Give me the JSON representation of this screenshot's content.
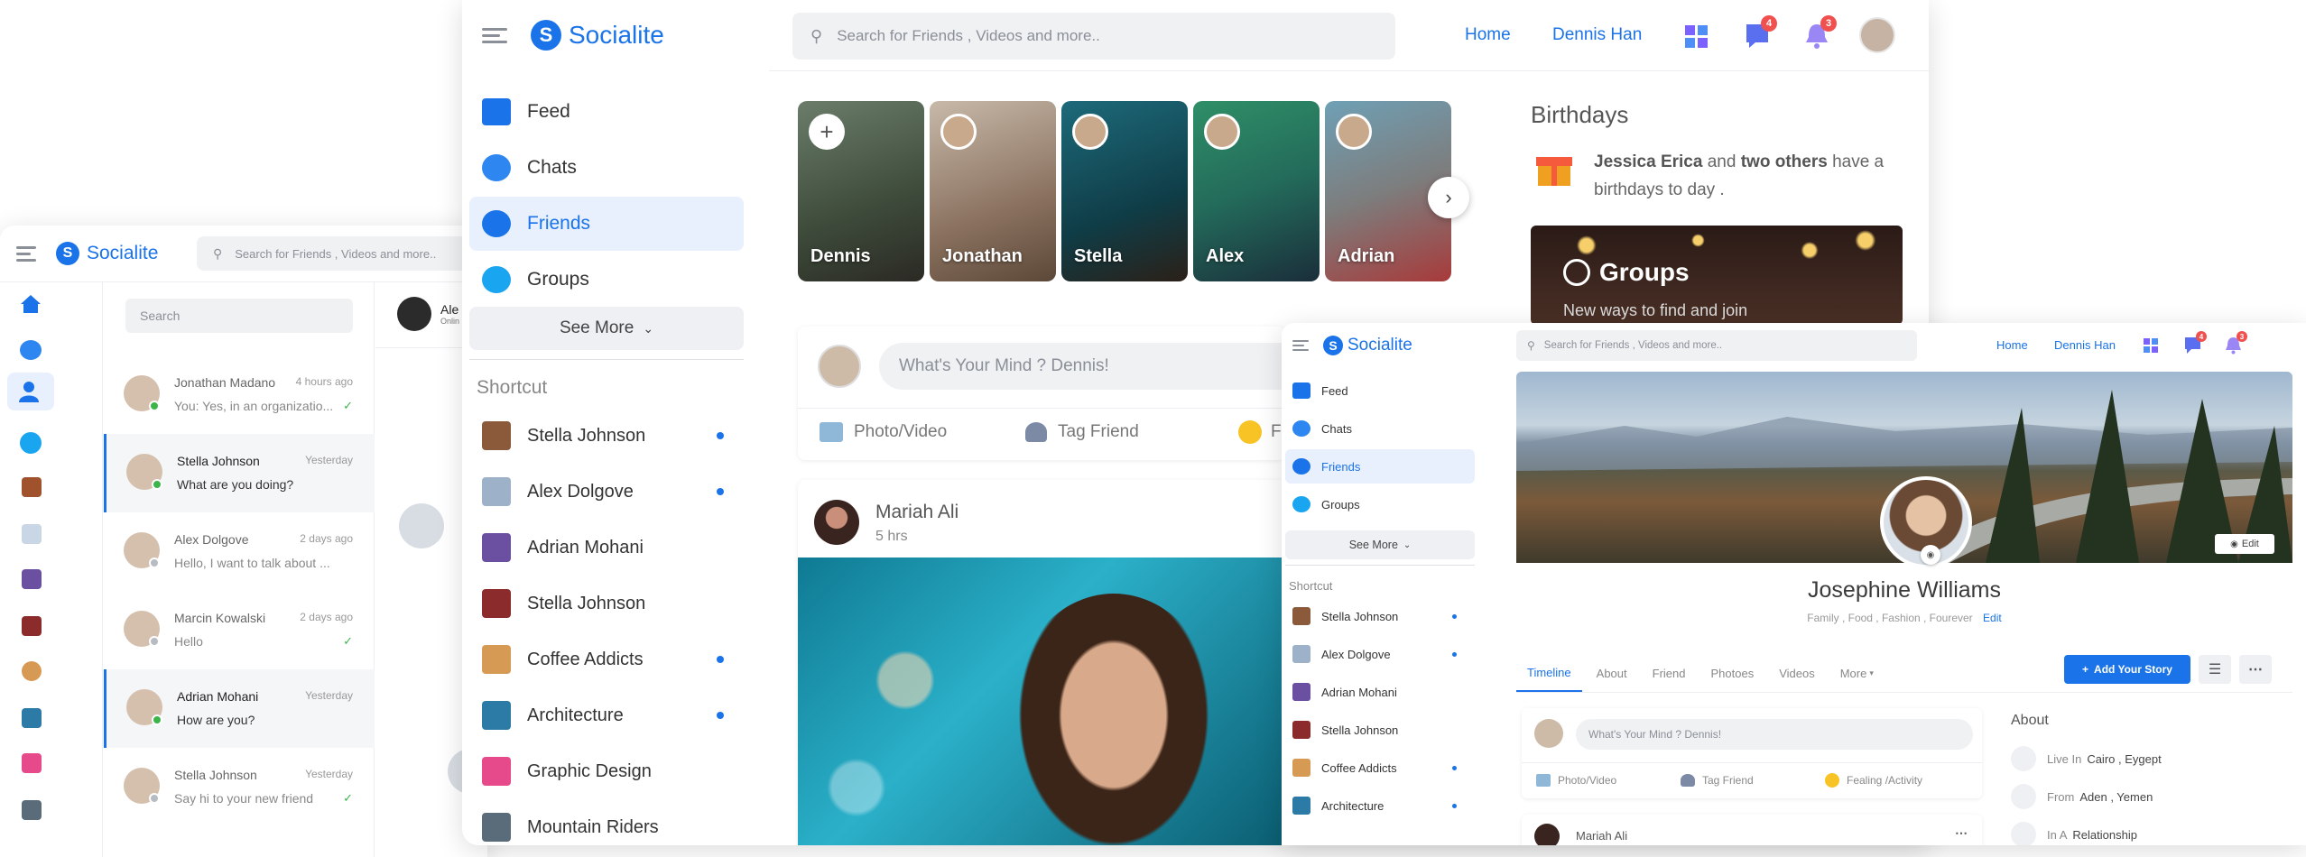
{
  "brand": "Socialite",
  "colors": {
    "accent": "#1a73e8",
    "badge": "#f0514f",
    "active_bg": "#e8f0fe"
  },
  "main": {
    "search_placeholder": "Search for Friends , Videos and more..",
    "nav": {
      "home": "Home",
      "user": "Dennis Han"
    },
    "badges": {
      "messages": "4",
      "notifications": "3"
    },
    "sidebar": [
      {
        "label": "Feed",
        "icon": "home-icon"
      },
      {
        "label": "Chats",
        "icon": "chat-icon"
      },
      {
        "label": "Friends",
        "icon": "friends-icon"
      },
      {
        "label": "Groups",
        "icon": "groups-icon"
      }
    ],
    "see_more": "See More",
    "shortcut_title": "Shortcut",
    "shortcuts": [
      {
        "label": "Stella Johnson",
        "dot": true
      },
      {
        "label": "Alex Dolgove",
        "dot": true
      },
      {
        "label": "Adrian Mohani",
        "dot": false
      },
      {
        "label": "Stella Johnson",
        "dot": false
      },
      {
        "label": "Coffee Addicts",
        "dot": true
      },
      {
        "label": "Architecture",
        "dot": true
      },
      {
        "label": "Graphic Design",
        "dot": false
      },
      {
        "label": "Mountain Riders",
        "dot": false
      }
    ],
    "stories": [
      "Dennis",
      "Jonathan",
      "Stella",
      "Alex",
      "Adrian"
    ],
    "composer": {
      "placeholder": "What's Your Mind ? Dennis!",
      "photo": "Photo/Video",
      "tag": "Tag Friend",
      "feeling": "Fe"
    },
    "post": {
      "author": "Mariah Ali",
      "time": "5 hrs"
    },
    "birthdays": {
      "title": "Birthdays",
      "name": "Jessica Erica",
      "and": "and",
      "others": "two others",
      "rest": "have a birthdays to day ."
    },
    "groups_card": {
      "title": "Groups",
      "subtitle": "New ways to find and join"
    }
  },
  "chat_app": {
    "search_placeholder": "Search for Friends , Videos and more..",
    "list_search": "Search",
    "header_name": "Ale",
    "header_status": "Onlin",
    "conversations": [
      {
        "name": "Jonathan Madano",
        "time": "4 hours ago",
        "msg": "You: Yes, in an organizatio...",
        "check": true,
        "active": false,
        "online": true
      },
      {
        "name": "Stella Johnson",
        "time": "Yesterday",
        "msg": "What are you doing?",
        "check": false,
        "active": true,
        "online": true
      },
      {
        "name": "Alex Dolgove",
        "time": "2 days ago",
        "msg": "Hello, I want to talk about ...",
        "check": false,
        "active": false,
        "online": false
      },
      {
        "name": "Marcin Kowalski",
        "time": "2 days ago",
        "msg": "Hello",
        "check": true,
        "active": false,
        "online": false
      },
      {
        "name": "Adrian Mohani",
        "time": "Yesterday",
        "msg": "How are you?",
        "check": false,
        "active": true,
        "online": true
      },
      {
        "name": "Stella Johnson",
        "time": "Yesterday",
        "msg": "Say hi to your new friend",
        "check": true,
        "active": false,
        "online": false
      }
    ]
  },
  "profile_app": {
    "search_placeholder": "Search for Friends , Videos and more..",
    "nav": {
      "home": "Home",
      "user": "Dennis Han"
    },
    "badges": {
      "messages": "4",
      "notifications": "3"
    },
    "sidebar": [
      "Feed",
      "Chats",
      "Friends",
      "Groups"
    ],
    "see_more": "See More",
    "shortcut_title": "Shortcut",
    "shortcuts": [
      {
        "label": "Stella Johnson",
        "dot": true
      },
      {
        "label": "Alex Dolgove",
        "dot": true
      },
      {
        "label": "Adrian Mohani",
        "dot": false
      },
      {
        "label": "Stella Johnson",
        "dot": false
      },
      {
        "label": "Coffee Addicts",
        "dot": true
      },
      {
        "label": "Architecture",
        "dot": true
      }
    ],
    "cover_edit": "Edit",
    "name": "Josephine Williams",
    "interests": "Family , Food , Fashion , Fourever",
    "interests_edit": "Edit",
    "tabs": [
      "Timeline",
      "About",
      "Friend",
      "Photoes",
      "Videos",
      "More"
    ],
    "add_story": "Add Your Story",
    "composer": {
      "placeholder": "What's Your Mind ? Dennis!",
      "photo": "Photo/Video",
      "tag": "Tag Friend",
      "feeling": "Fealing /Activity"
    },
    "about_title": "About",
    "about": [
      {
        "prefix": "Live In",
        "value": "Cairo , Eygept"
      },
      {
        "prefix": "From",
        "value": "Aden , Yemen"
      },
      {
        "prefix": "In A",
        "value": "Relationship"
      }
    ],
    "post_author": "Mariah Ali"
  }
}
